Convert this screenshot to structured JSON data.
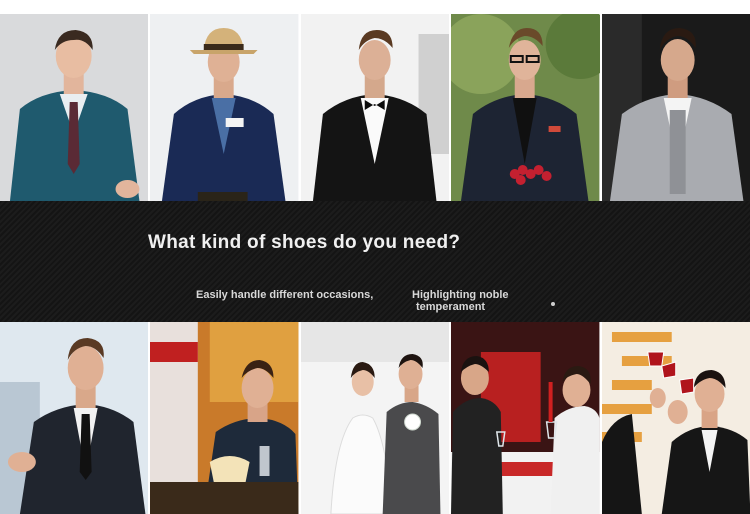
{
  "banner": {
    "headline": "What kind of shoes do you need?",
    "subtitle_left": "Easily handle different occasions,",
    "subtitle_right_line1": "Highlighting noble",
    "subtitle_right_line2": "temperament"
  },
  "colors": {
    "banner_bg": "#171717",
    "headline_text": "#f0f0f0",
    "page_bg": "#ffffff"
  }
}
